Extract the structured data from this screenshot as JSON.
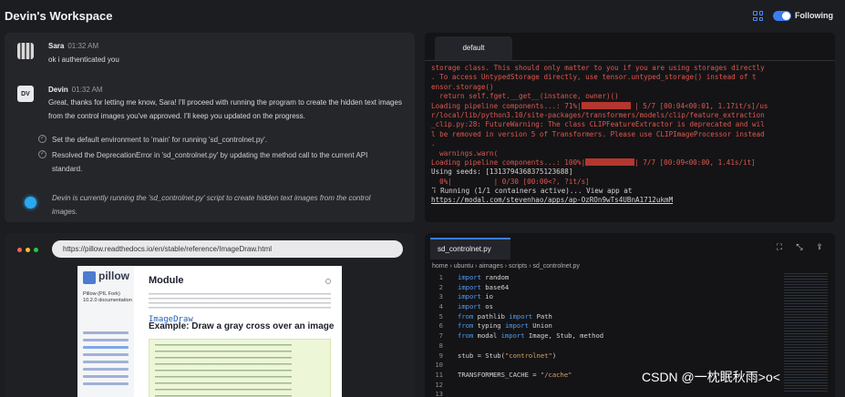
{
  "workspace": {
    "title": "Devin's Workspace",
    "following_label": "Following",
    "following_on": true,
    "accent": "#3d7cf0"
  },
  "chat": {
    "messages": [
      {
        "author": "Sara",
        "time": "01:32 AM",
        "text": "ok i authenticated you"
      },
      {
        "author": "Devin",
        "avatar_text": "DV",
        "time": "01:32 AM",
        "text": "Great, thanks for letting me know, Sara! I'll proceed with running the program to create the hidden text images from the control images you've approved. I'll keep you updated on the progress."
      }
    ],
    "steps": [
      "Set the default environment to 'main' for running 'sd_controlnet.py'.",
      "Resolved the DeprecationError in 'sd_controlnet.py' by updating the method call to the current API standard."
    ],
    "status_text": "Devin is currently running the 'sd_controlnet.py' script to create hidden text images from the control images."
  },
  "terminal": {
    "tab": "default",
    "lines": [
      {
        "color": "red",
        "text": "storage class. This should only matter to you if you are using storages directly"
      },
      {
        "color": "red",
        "text": ". To access UntypedStorage directly, use tensor.untyped_storage() instead of t"
      },
      {
        "color": "red",
        "text": "ensor.storage()"
      },
      {
        "color": "red",
        "text": "  return self.fget.__get__(instance, owner)()"
      },
      {
        "color": "red",
        "text": "Loading pipeline components...: 71%|",
        "bar": true,
        "after": " | 5/7 [00:04<00:01, 1.17it/s]/us"
      },
      {
        "color": "red",
        "text": "r/local/lib/python3.10/site-packages/transformers/models/clip/feature_extraction"
      },
      {
        "color": "red",
        "text": "_clip.py:28: FutureWarning: The class CLIPFeatureExtractor is deprecated and wil"
      },
      {
        "color": "red",
        "text": "l be removed in version 5 of Transformers. Please use CLIPImageProcessor instead"
      },
      {
        "color": "red",
        "text": "."
      },
      {
        "color": "red",
        "text": "  warnings.warn("
      },
      {
        "color": "red",
        "text": "Loading pipeline components...: 100%|",
        "bar": true,
        "after": "| 7/7 [00:09<00:00, 1.41s/it]"
      },
      {
        "color": "white",
        "text": "Using seeds: [1313794368375123688]"
      },
      {
        "color": "red",
        "text": "  0%|          | 0/30 [00:00<?, ?it/s]"
      },
      {
        "color": "white",
        "text": "⠹ Running (1/1 containers active)... View app at"
      },
      {
        "color": "link",
        "text": "https://modal.com/stevenhao/apps/ap-OzROn9wTs4UBnA1712ukmM"
      }
    ]
  },
  "browser": {
    "url": "https://pillow.readthedocs.io/en/stable/reference/ImageDraw.html",
    "dots": [
      "#ff5f57",
      "#febc2e",
      "#28c840"
    ],
    "doc": {
      "logo_text": "pillow",
      "sidebar_text": "Pillow (PIL Fork) 10.2.0 documentation",
      "module_code": "ImageDraw",
      "module_word": "Module",
      "example_heading": "Example: Draw a gray cross over an image"
    }
  },
  "editor": {
    "tab": "sd_controlnet.py",
    "breadcrumb": "home › ubuntu › aimages › scripts › sd_controlnet.py",
    "lines": [
      {
        "n": "1",
        "parts": [
          [
            "kw",
            "import "
          ],
          [
            "tx",
            "random"
          ]
        ]
      },
      {
        "n": "2",
        "parts": [
          [
            "kw",
            "import "
          ],
          [
            "tx",
            "base64"
          ]
        ]
      },
      {
        "n": "3",
        "parts": [
          [
            "kw",
            "import "
          ],
          [
            "tx",
            "io"
          ]
        ]
      },
      {
        "n": "4",
        "parts": [
          [
            "kw",
            "import "
          ],
          [
            "tx",
            "os"
          ]
        ]
      },
      {
        "n": "5",
        "parts": [
          [
            "kw",
            "from "
          ],
          [
            "tx",
            "pathlib "
          ],
          [
            "kw",
            "import "
          ],
          [
            "tx",
            "Path"
          ]
        ]
      },
      {
        "n": "6",
        "parts": [
          [
            "kw",
            "from "
          ],
          [
            "tx",
            "typing "
          ],
          [
            "kw",
            "import "
          ],
          [
            "tx",
            "Union"
          ]
        ]
      },
      {
        "n": "7",
        "parts": [
          [
            "kw",
            "from "
          ],
          [
            "tx",
            "modal "
          ],
          [
            "kw",
            "import "
          ],
          [
            "tx",
            "Image, Stub, method"
          ]
        ]
      },
      {
        "n": "8",
        "parts": []
      },
      {
        "n": "9",
        "parts": [
          [
            "tx",
            "stub = Stub("
          ],
          [
            "st",
            "\"controlnet\""
          ],
          [
            "tx",
            ")"
          ]
        ]
      },
      {
        "n": "10",
        "parts": []
      },
      {
        "n": "11",
        "parts": [
          [
            "tx",
            "TRANSFORMERS_CACHE = "
          ],
          [
            "st",
            "\"/cache\""
          ]
        ]
      },
      {
        "n": "12",
        "parts": []
      },
      {
        "n": "13",
        "parts": []
      }
    ]
  },
  "watermark": "CSDN @一枕眠秋雨>o<"
}
